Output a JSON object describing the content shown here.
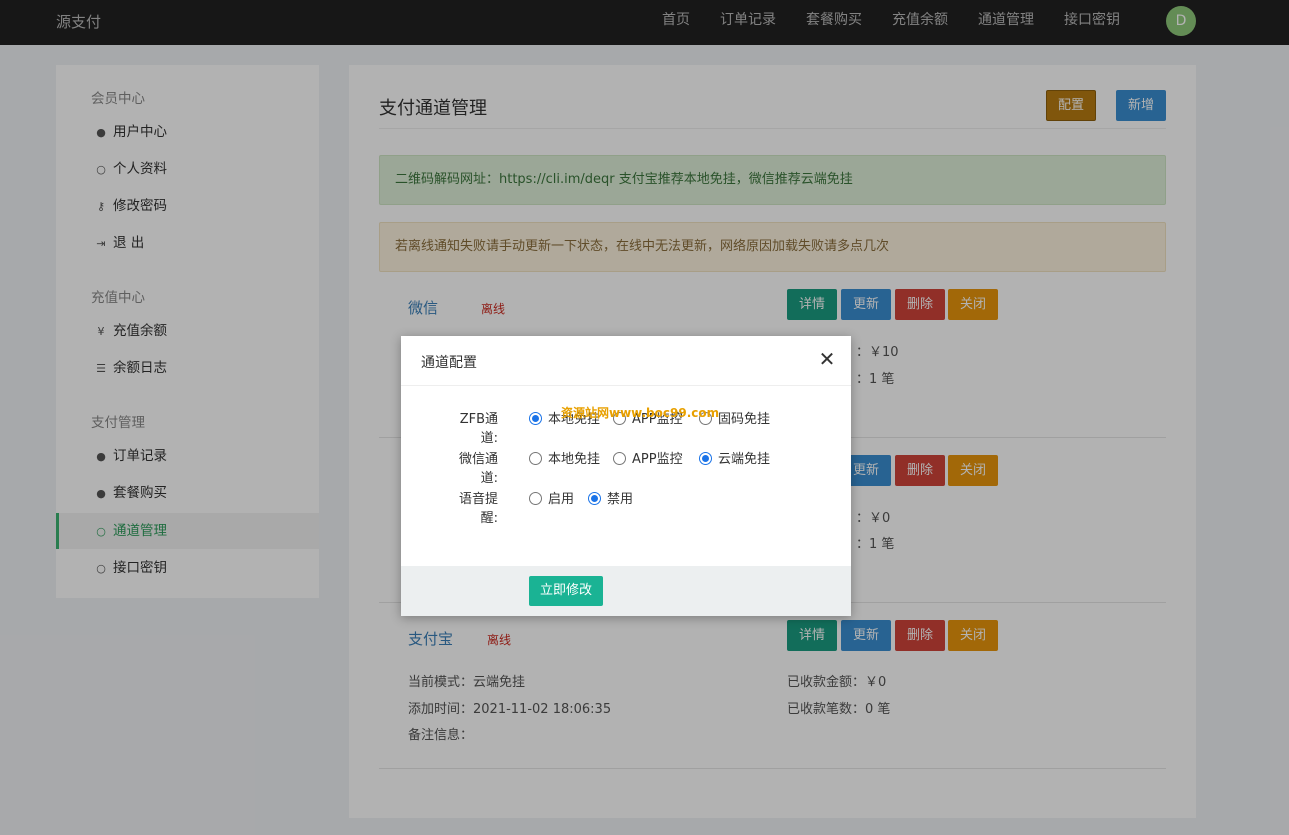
{
  "brand": "源支付",
  "nav": [
    "首页",
    "订单记录",
    "套餐购买",
    "充值余额",
    "通道管理",
    "接口密钥"
  ],
  "avatar_letter": "D",
  "sidebar": {
    "groups": [
      "会员中心",
      "充值中心",
      "支付管理"
    ],
    "items": [
      {
        "label": "用户中心",
        "icon": "user-circle-icon"
      },
      {
        "label": "个人资料",
        "icon": "user-icon"
      },
      {
        "label": "修改密码",
        "icon": "key-icon"
      },
      {
        "label": "退 出",
        "icon": "sign-out-icon"
      },
      {
        "label": "充值余额",
        "icon": "yen-icon"
      },
      {
        "label": "余额日志",
        "icon": "list-icon"
      },
      {
        "label": "订单记录",
        "icon": "user-circle-icon"
      },
      {
        "label": "套餐购买",
        "icon": "user-circle-icon"
      },
      {
        "label": "通道管理",
        "icon": "user-icon",
        "active": true
      },
      {
        "label": "接口密钥",
        "icon": "user-icon"
      }
    ]
  },
  "main": {
    "title": "支付通道管理",
    "config_button": "配置",
    "new_button": "新增",
    "alert_success": "二维码解码网址：https://cli.im/deqr   支付宝推荐本地免挂，微信推荐云端免挂",
    "alert_warning": "若离线通知失败请手动更新一下状态，在线中无法更新，网络原因加载失败请多点几次",
    "actions": {
      "detail": "详情",
      "update": "更新",
      "delete": "删除",
      "close": "关闭"
    },
    "channels": [
      {
        "name": "微信",
        "status": "离线",
        "amount_value": "：￥10",
        "count_value": "：1 笔"
      },
      {
        "amount_value": "：￥0",
        "count_value": "：1 笔"
      },
      {
        "name": "支付宝",
        "status": "离线",
        "mode_label": "当前模式：",
        "mode": "云端免挂",
        "time_label": "添加时间：",
        "time": "2021-11-02 18:06:35",
        "note_label": "备注信息：",
        "amount_label": "已收款金额：",
        "amount": "￥0",
        "count_label": "已收款笔数：",
        "count": "0 笔"
      }
    ]
  },
  "modal": {
    "title": "通道配置",
    "fields": [
      {
        "label": "ZFB通道:",
        "options": [
          "本地免挂",
          "APP监控",
          "固码免挂"
        ],
        "selected": 0
      },
      {
        "label": "微信通道:",
        "options": [
          "本地免挂",
          "APP监控",
          "云端免挂"
        ],
        "selected": 2
      },
      {
        "label": "语音提醒:",
        "options": [
          "启用",
          "禁用"
        ],
        "selected": 1
      }
    ],
    "watermark": "资源站网www.boc99.com",
    "submit": "立即修改"
  }
}
